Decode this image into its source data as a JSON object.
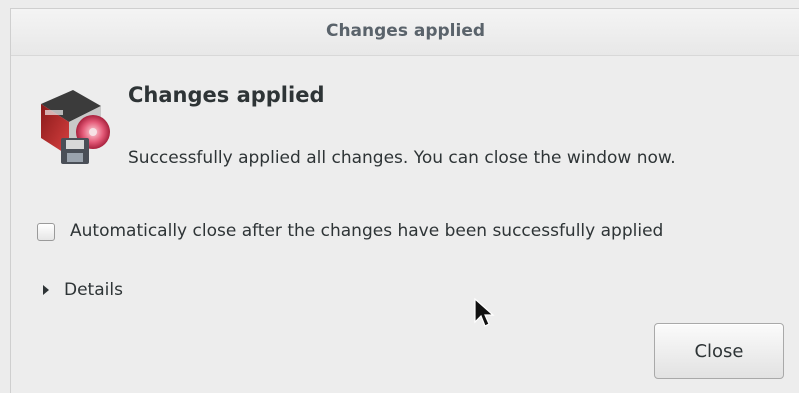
{
  "window": {
    "title": "Changes applied"
  },
  "dialog": {
    "icon": "software-update-icon",
    "heading": "Changes applied",
    "message": "Successfully applied all changes. You can close the window now.",
    "auto_close_checkbox": {
      "label": "Automatically close after the changes have been successfully applied",
      "checked": false
    },
    "details_expander": {
      "label": "Details",
      "expanded": false
    },
    "close_button_label": "Close"
  },
  "colors": {
    "background": "#ededed",
    "text": "#2e3436",
    "title_text": "#5a636b"
  }
}
